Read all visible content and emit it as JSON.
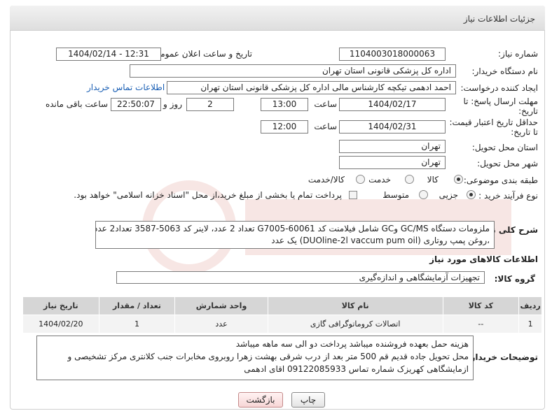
{
  "header": {
    "title": "جزئیات اطلاعات نیاز"
  },
  "fields": {
    "need_number_label": "شماره نیاز:",
    "need_number": "1104003018000063",
    "announce_label": "تاریخ و ساعت اعلان عمومی:",
    "announce_value": "1404/02/14 - 12:31",
    "buyer_org_label": "نام دستگاه خریدار:",
    "buyer_org": "اداره کل پزشکی قانونی استان تهران",
    "creator_label": "ایجاد کننده درخواست:",
    "creator": "احمد ادهمی تیکچه کارشناس مالی اداره کل پزشکی قانونی استان تهران",
    "contact_link": "اطلاعات تماس خریدار",
    "deadline_label_1": "مهلت ارسال پاسخ: تا",
    "deadline_label_2": "تاریخ:",
    "deadline_date": "1404/02/17",
    "time_label": "ساعت",
    "deadline_time": "13:00",
    "days_value": "2",
    "days_label": "روز و",
    "remaining_time": "22:50:07",
    "remaining_label": "ساعت باقی مانده",
    "validity_label_1": "حداقل تاریخ اعتبار قیمت:",
    "validity_label_2": "تا تاریخ:",
    "validity_date": "1404/02/31",
    "validity_time": "12:00",
    "province_label": "استان محل تحویل:",
    "province": "تهران",
    "city_label": "شهر محل تحویل:",
    "city": "تهران",
    "category_label": "طبقه بندی موضوعی:",
    "category_options": [
      "کالا",
      "خدمت",
      "کالا/خدمت"
    ],
    "process_label": "نوع فرآیند خرید :",
    "process_options": [
      "جزیی",
      "متوسط"
    ],
    "payment_note": "پرداخت تمام یا بخشی از مبلغ خرید،از محل \"اسناد خزانه اسلامی\" خواهد بود."
  },
  "summary": {
    "label": "شرح کلی نیاز:",
    "line1": "ملزومات دستگاه GC/MS وGC شامل فیلامنت کد G7005-60061 تعداد 2 عدد، لاینر کد 5063-3587 تعداد2 عدد",
    "line2": "،روغن پمپ روتاری (DUOline-2l vaccum pum oil) یک عدد"
  },
  "goods": {
    "section_title": "اطلاعات کالاهای مورد نیاز",
    "group_label": "گروه کالا:",
    "group_value": "تجهیزات آزمایشگاهی و اندازه‌گیری",
    "columns": [
      "ردیف",
      "کد کالا",
      "نام کالا",
      "واحد شمارش",
      "تعداد / مقدار",
      "تاریخ نیاز"
    ],
    "rows": [
      [
        "1",
        "--",
        "اتصالات کروماتوگرافی گازی",
        "عدد",
        "1",
        "1404/02/20"
      ]
    ]
  },
  "buyer_notes": {
    "label": "توضیحات خریدار:",
    "lines": [
      "هزینه حمل بعهده فروشنده میباشد پرداخت دو الی سه ماهه میباشد",
      "محل تحویل جاده قدیم قم 500 متر بعد از درب شرقی بهشت زهرا روبروی مخابرات جنب کلانتری مرکز تشخیصی و",
      "ازمایشگاهی کهریزک شماره تماس 09122085933 اقای ادهمی"
    ]
  },
  "buttons": {
    "print": "چاپ",
    "back": "بازگشت"
  },
  "colors": {
    "link": "#1a5fb4",
    "header_bg": "#e6e6e6",
    "table_header": "#d6d6d6"
  }
}
